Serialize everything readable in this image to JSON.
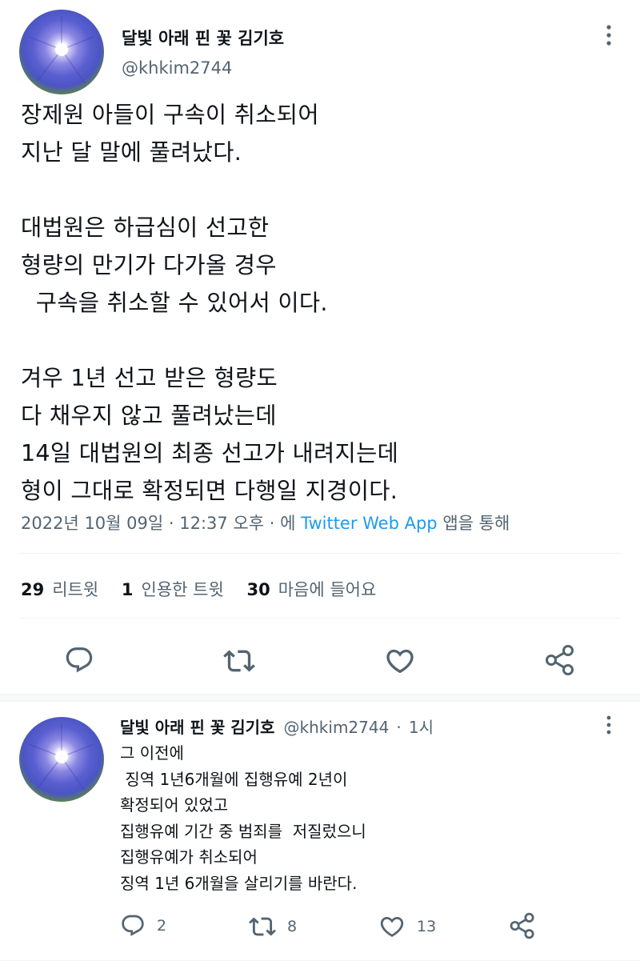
{
  "main_tweet": {
    "author_name": "달빛 아래 핀 꽃 김기호",
    "handle": "@khkim2744",
    "lines": [
      "장제원 아들이 구속이 취소되어",
      "지난 달 말에 풀려났다.",
      "",
      "대법원은 하급심이 선고한",
      "형량의 만기가 다가올 경우",
      "  구속을 취소할 수 있어서 이다.",
      "",
      "겨우 1년 선고 받은 형량도",
      "다 채우지 않고 풀려났는데",
      "14일 대법원의 최종 선고가 내려지는데",
      "형이 그대로 확정되면 다행일 지경이다."
    ],
    "timestamp": "2022년 10월 09일 · 12:37 오후 · 에",
    "source_app": "Twitter Web App",
    "source_suffix": "앱을 통해",
    "stats": {
      "retweets_count": "29",
      "retweets_label": "리트윗",
      "quotes_count": "1",
      "quotes_label": "인용한 트윗",
      "likes_count": "30",
      "likes_label": "마음에 들어요"
    },
    "actions": [
      "reply",
      "retweet",
      "like",
      "share"
    ]
  },
  "reply_tweet": {
    "author_name": "달빛 아래 핀 꽃 김기호",
    "handle": "@khkim2744",
    "dot": "·",
    "time_ago": "1시",
    "lines": [
      "그 이전에",
      " 징역 1년6개월에 집행유예 2년이",
      "확정되어 있었고",
      "집행유예 기간 중 범죄를  저질렀으니",
      "집행유예가 취소되어",
      "징역 1년 6개월을 살리기를 바란다."
    ],
    "reply_count": "2",
    "retweet_count": "8",
    "like_count": "13"
  },
  "colors": {
    "text_primary": "#0f1419",
    "text_secondary": "#536471",
    "link": "#1d9bf0",
    "divider": "#eff3f4"
  }
}
